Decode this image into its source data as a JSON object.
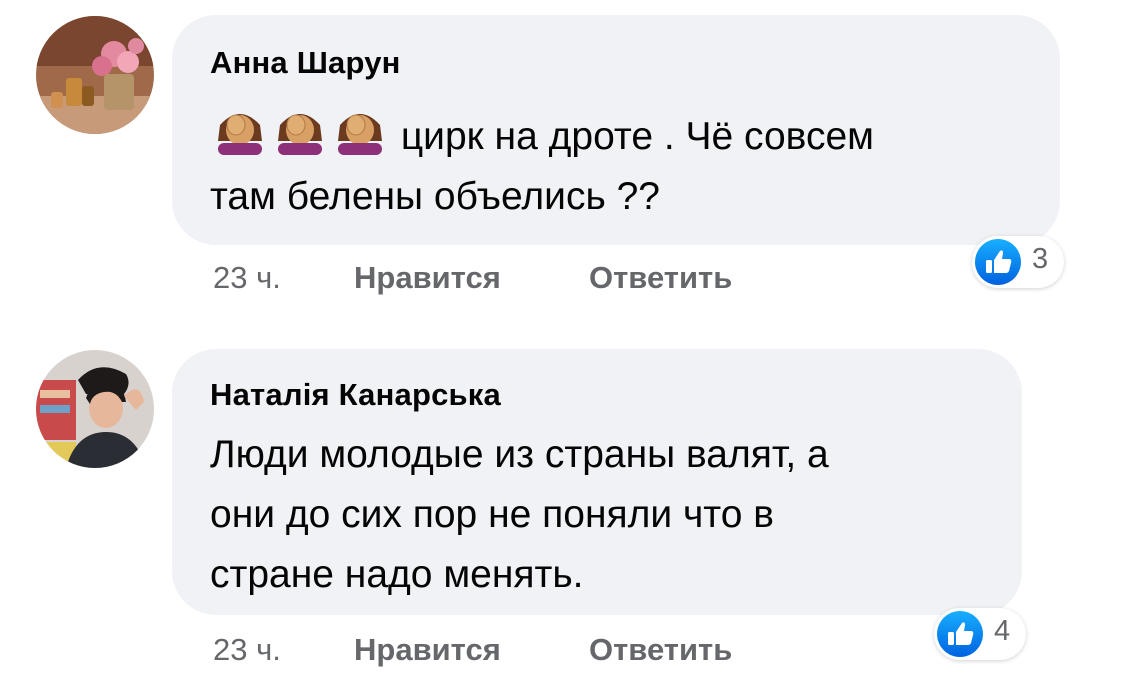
{
  "comments": [
    {
      "author": "Анна Шарун",
      "line1": "цирк на дроте .  Чё совсем",
      "line2": "там белены объелись ??",
      "emoji": "face-palm-woman-icon",
      "time": "23 ч.",
      "like_label": "Нравится",
      "reply_label": "Ответить",
      "reaction_count": "3"
    },
    {
      "author": "Наталія Канарська",
      "line1": "Люди молодые из страны валят, а",
      "line2": "они до сих пор не поняли что в",
      "line3": "стране надо менять.",
      "time": "23 ч.",
      "like_label": "Нравится",
      "reply_label": "Ответить",
      "reaction_count": "4"
    }
  ],
  "colors": {
    "bubble": "#f0f2f5",
    "meta_text": "#65676b",
    "like_blue": "#1877f2"
  }
}
